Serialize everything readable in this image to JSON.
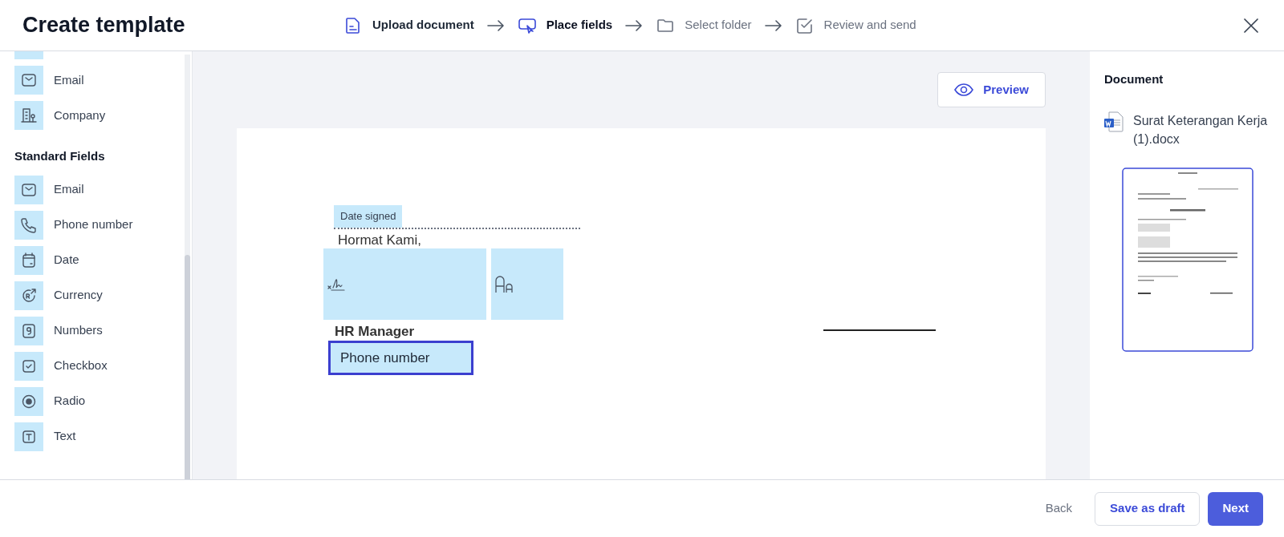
{
  "header": {
    "title": "Create template",
    "steps": [
      {
        "label": "Upload document",
        "completed": true,
        "selected": false
      },
      {
        "label": "Place fields",
        "completed": false,
        "selected": true
      },
      {
        "label": "Select folder",
        "completed": false,
        "selected": false
      },
      {
        "label": "Review and send",
        "completed": false,
        "selected": false
      }
    ]
  },
  "sidebar": {
    "groups": [
      {
        "items": [
          {
            "label": "Email",
            "kind": "email"
          },
          {
            "label": "Company",
            "kind": "company"
          }
        ]
      },
      {
        "title": "Standard Fields",
        "items": [
          {
            "label": "Email",
            "kind": "email"
          },
          {
            "label": "Phone number",
            "kind": "phone"
          },
          {
            "label": "Date",
            "kind": "date"
          },
          {
            "label": "Currency",
            "kind": "currency"
          },
          {
            "label": "Numbers",
            "kind": "numbers"
          },
          {
            "label": "Checkbox",
            "kind": "checkbox"
          },
          {
            "label": "Radio",
            "kind": "radio"
          },
          {
            "label": "Text",
            "kind": "text"
          }
        ]
      }
    ]
  },
  "canvas": {
    "preview_button": "Preview",
    "document_lines": [
      {
        "text": "Hormat Kami,",
        "kind": "plain"
      },
      {
        "text": "HR Manager",
        "kind": "bold"
      }
    ],
    "placed_fields": [
      {
        "kind": "label",
        "label": "Date signed",
        "selected": false
      },
      {
        "kind": "signature",
        "selected": false
      },
      {
        "kind": "initials",
        "selected": false
      },
      {
        "kind": "input",
        "label": "Phone number",
        "selected": true
      }
    ]
  },
  "document_panel": {
    "title": "Document",
    "file_name": "Surat Keterangan Kerja (1).docx"
  },
  "footer": {
    "back": "Back",
    "save_draft": "Save as draft",
    "next": "Next"
  }
}
